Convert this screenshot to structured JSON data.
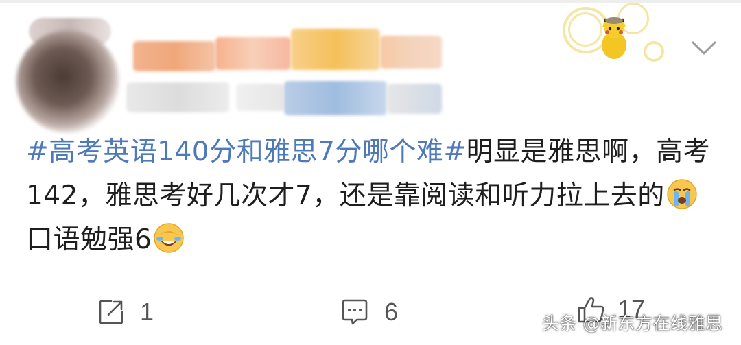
{
  "post": {
    "hashtag": "#高考英语140分和雅思7分哪个难#",
    "text_part1": "明显是雅思啊，高考142，雅思考好几次才7，还是靠阅读和听力拉上去的",
    "text_part2": "口语勉强6"
  },
  "actions": {
    "repost_count": "1",
    "comment_count": "6",
    "like_count": "17"
  },
  "watermark": "头条 @新东方在线雅思",
  "icons": {
    "repost": "share-icon",
    "comment": "comment-icon",
    "like": "thumbs-up-icon",
    "more": "chevron-down-icon",
    "emoji1": "crying-face-emoji",
    "emoji2": "laughing-cover-face-emoji"
  },
  "colors": {
    "hashtag": "#4f7ab8",
    "text": "#1e1e1e",
    "icon": "#555555"
  }
}
